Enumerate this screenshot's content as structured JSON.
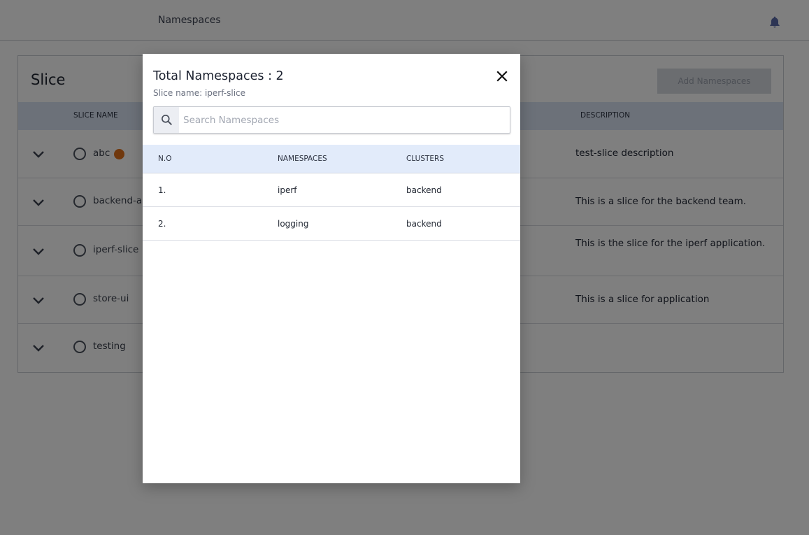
{
  "topbar": {
    "title": "Namespaces"
  },
  "card": {
    "title": "Slice",
    "add_button": "Add Namespaces",
    "columns": {
      "slice_name": "SLICE NAME",
      "description": "DESCRIPTION"
    },
    "rows": [
      {
        "name": "abc",
        "description": "test-slice description"
      },
      {
        "name": "backend-app",
        "description": "This is a slice for the backend team."
      },
      {
        "name": "iperf-slice",
        "description": "This is the slice for the iperf application."
      },
      {
        "name": "store-ui",
        "description": "This is a slice for application"
      },
      {
        "name": "testing",
        "description": ""
      }
    ]
  },
  "modal": {
    "title": "Total Namespaces : 2",
    "subtitle": "Slice name: iperf-slice",
    "search_placeholder": "Search Namespaces",
    "columns": {
      "no": "N.O",
      "namespaces": "NAMESPACES",
      "clusters": "CLUSTERS"
    },
    "rows": [
      {
        "no": "1.",
        "namespace": "iperf",
        "cluster": "backend"
      },
      {
        "no": "2.",
        "namespace": "logging",
        "cluster": "backend"
      }
    ]
  },
  "colors": {
    "overlay": "#000000",
    "header_bg": "#d9e2f2",
    "clock_badge": "#e0701a"
  },
  "icons": [
    "bell-icon",
    "chevron-down-icon",
    "radio-icon",
    "clock-icon",
    "close-icon",
    "search-icon"
  ]
}
